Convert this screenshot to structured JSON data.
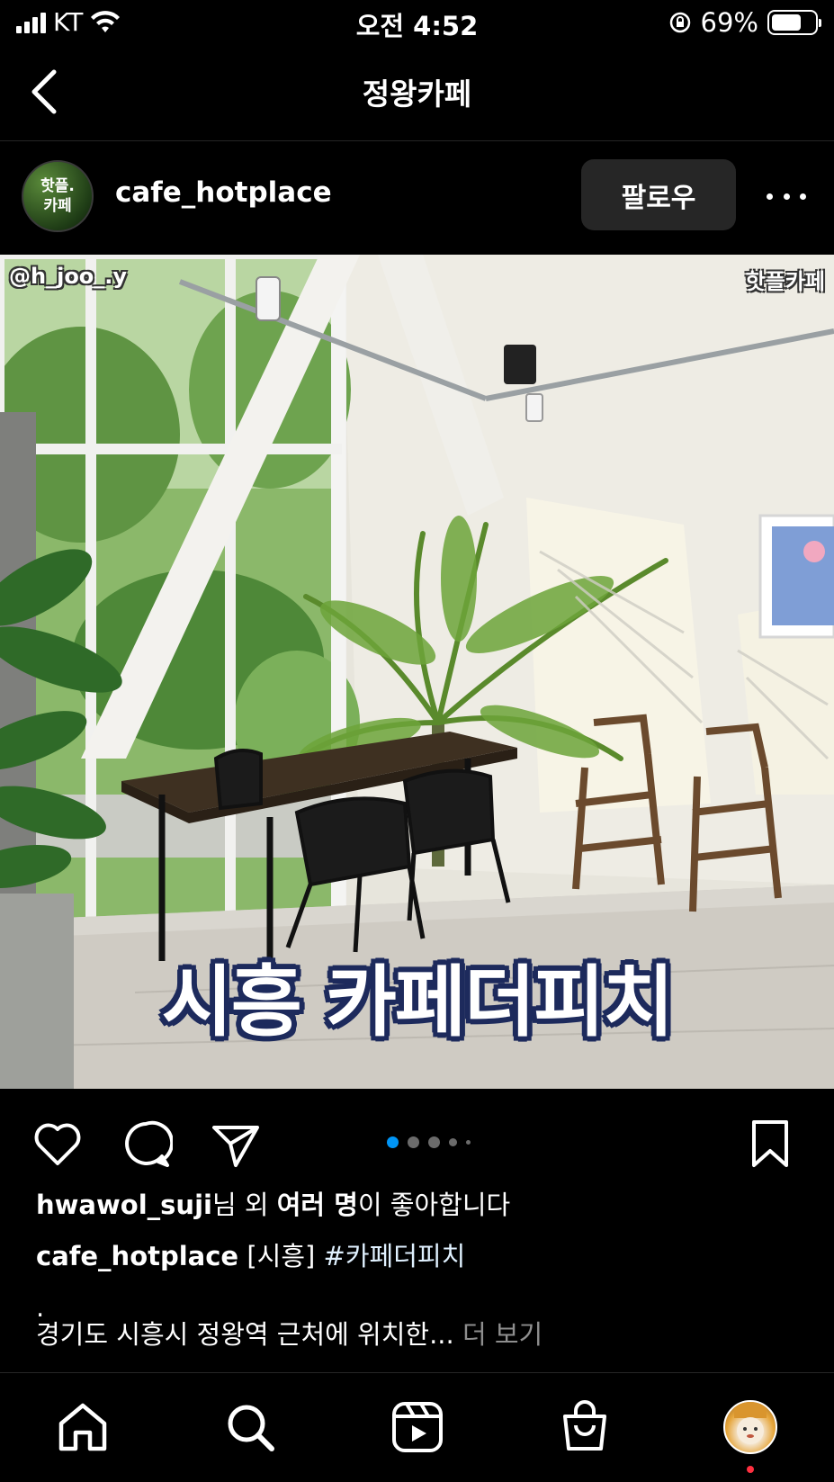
{
  "status_bar": {
    "carrier": "KT",
    "time": "오전 4:52",
    "battery_percent": "69%",
    "battery_level": 0.69
  },
  "header": {
    "title": "정왕카페"
  },
  "post": {
    "avatar_text_top": "핫플.",
    "avatar_text_bottom": "카페",
    "username": "cafe_hotplace",
    "follow_label": "팔로우",
    "image": {
      "credit": "@h_joo_.y",
      "brand": "핫플카페",
      "overlay_title": "시흥 카페더피치"
    },
    "carousel": {
      "count": 5,
      "active_index": 0
    },
    "likes": {
      "user": "hwawol_suji",
      "text_a": "님 외 ",
      "text_b": "여러 명",
      "text_c": "이 좋아합니다"
    },
    "caption": {
      "username": "cafe_hotplace",
      "text": " [시흥] ",
      "hashtag": "#카페더피치",
      "dot": ".",
      "preview": "경기도 시흥시 정왕역 근처에 위치한... ",
      "more_label": "더 보기"
    }
  },
  "colors": {
    "background": "#000000",
    "active_dot": "#0095f6",
    "follow_button": "#262626",
    "notification": "#ff3040"
  },
  "tab_bar": {
    "icons": [
      "home-icon",
      "search-icon",
      "reels-icon",
      "shop-icon",
      "profile-avatar"
    ]
  }
}
